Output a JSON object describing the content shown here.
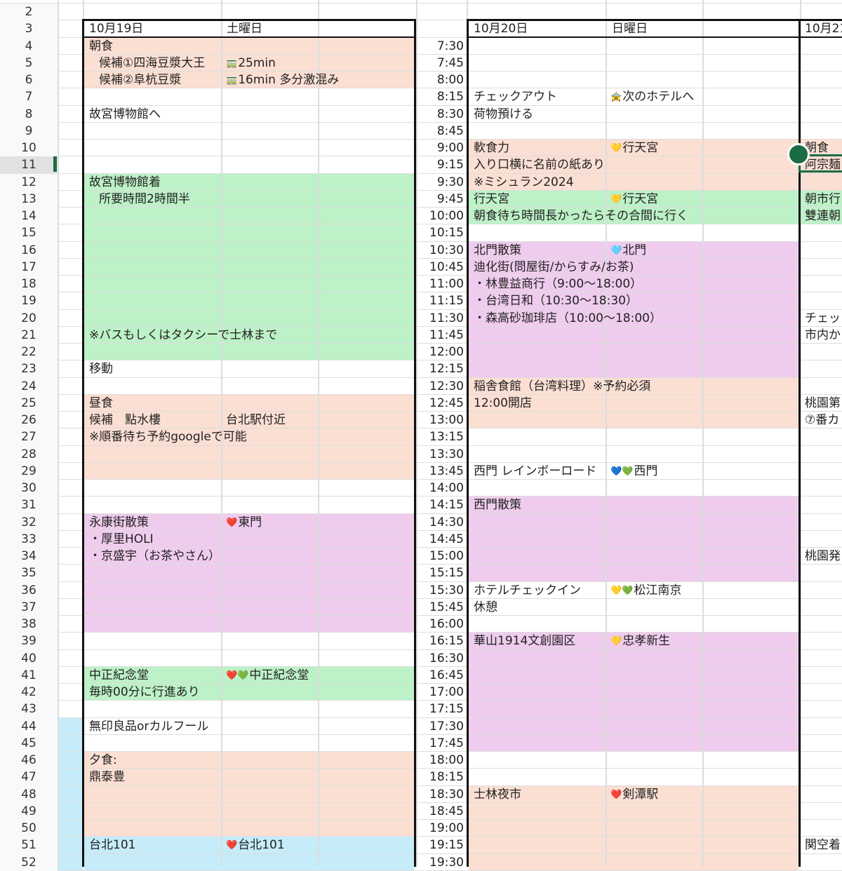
{
  "colors": {
    "breakfast": "#fbdfd3",
    "sight": "#bdf1c7",
    "walk": "#efcced",
    "blue": "#c6ecf9",
    "selection": "#1b6b43",
    "grid": "#dddddd"
  },
  "row_numbers": [
    "2",
    "3",
    "4",
    "5",
    "6",
    "7",
    "8",
    "9",
    "10",
    "11",
    "12",
    "13",
    "14",
    "15",
    "16",
    "17",
    "18",
    "19",
    "20",
    "21",
    "22",
    "23",
    "24",
    "25",
    "26",
    "27",
    "28",
    "29",
    "30",
    "31",
    "32",
    "33",
    "34",
    "35",
    "36",
    "37",
    "38",
    "39",
    "40",
    "41",
    "42",
    "43",
    "44",
    "45",
    "46",
    "47",
    "48",
    "49",
    "50",
    "51",
    "52"
  ],
  "selected_row": "11",
  "day1": {
    "date": "10月19日",
    "weekday": "土曜日",
    "cells": [
      {
        "r": 4,
        "c": "a",
        "text": "朝食"
      },
      {
        "r": 5,
        "c": "ai",
        "text": "候補①四海豆漿大王"
      },
      {
        "r": 5,
        "c": "b",
        "icon": "🚃",
        "icon_name": "train-icon",
        "text": "25min"
      },
      {
        "r": 6,
        "c": "ai",
        "text": "候補②阜杭豆漿"
      },
      {
        "r": 6,
        "c": "b",
        "icon": "🚃",
        "icon_name": "train-icon",
        "text": "16min 多分激混み"
      },
      {
        "r": 8,
        "c": "a",
        "text": "故宮博物館へ"
      },
      {
        "r": 12,
        "c": "a",
        "text": "故宮博物館着"
      },
      {
        "r": 13,
        "c": "ai",
        "text": "所要時間2時間半"
      },
      {
        "r": 21,
        "c": "a",
        "text": "※バスもしくはタクシーで士林まで"
      },
      {
        "r": 23,
        "c": "a",
        "text": "移動"
      },
      {
        "r": 25,
        "c": "a",
        "text": "昼食"
      },
      {
        "r": 26,
        "c": "a",
        "text": "候補　點水樓"
      },
      {
        "r": 26,
        "c": "b",
        "text": "台北駅付近"
      },
      {
        "r": 27,
        "c": "a",
        "text": "※順番待ち予約googleで可能"
      },
      {
        "r": 32,
        "c": "a",
        "text": "永康街散策"
      },
      {
        "r": 32,
        "c": "b",
        "icon": "❤️",
        "icon_name": "red-heart-icon",
        "text": "東門"
      },
      {
        "r": 33,
        "c": "a",
        "text": "・厚里HOLI"
      },
      {
        "r": 34,
        "c": "a",
        "text": "・京盛宇（お茶やさん）"
      },
      {
        "r": 41,
        "c": "a",
        "text": "中正紀念堂"
      },
      {
        "r": 41,
        "c": "b",
        "icon": "❤️💚",
        "icon_name": "red-green-heart-icon",
        "text": "中正紀念堂"
      },
      {
        "r": 42,
        "c": "a",
        "text": "毎時00分に行進あり"
      },
      {
        "r": 44,
        "c": "a",
        "text": "無印良品orカルフール"
      },
      {
        "r": 46,
        "c": "a",
        "text": "夕食:"
      },
      {
        "r": 47,
        "c": "a",
        "text": "鼎泰豊"
      },
      {
        "r": 51,
        "c": "a",
        "text": "台北101"
      },
      {
        "r": 51,
        "c": "b",
        "icon": "❤️",
        "icon_name": "red-heart-icon",
        "text": "台北101"
      }
    ]
  },
  "times": [
    "7:30",
    "7:45",
    "8:00",
    "8:15",
    "8:30",
    "8:45",
    "9:00",
    "9:15",
    "9:30",
    "9:45",
    "10:00",
    "10:15",
    "10:30",
    "10:45",
    "11:00",
    "11:15",
    "11:30",
    "11:45",
    "12:00",
    "12:15",
    "12:30",
    "12:45",
    "13:00",
    "13:15",
    "13:30",
    "13:45",
    "14:00",
    "14:15",
    "14:30",
    "14:45",
    "15:00",
    "15:15",
    "15:30",
    "15:45",
    "16:00",
    "16:15",
    "16:30",
    "16:45",
    "17:00",
    "17:15",
    "17:30",
    "17:45",
    "18:00",
    "18:15",
    "18:30",
    "18:45",
    "19:00",
    "19:15",
    "19:30"
  ],
  "day2": {
    "date": "10月20日",
    "weekday": "日曜日",
    "cells": [
      {
        "r": 7,
        "c": "a",
        "text": "チェックアウト"
      },
      {
        "r": 7,
        "c": "b",
        "icon": "🚖",
        "icon_name": "taxi-icon",
        "text": "次のホテルへ"
      },
      {
        "r": 8,
        "c": "a",
        "text": "荷物預ける"
      },
      {
        "r": 10,
        "c": "a",
        "text": "軟食力"
      },
      {
        "r": 10,
        "c": "b",
        "icon": "💛",
        "icon_name": "yellow-heart-icon",
        "text": "行天宮"
      },
      {
        "r": 11,
        "c": "a",
        "text": "入り口横に名前の紙あり"
      },
      {
        "r": 12,
        "c": "a",
        "text": "※ミシュラン2024"
      },
      {
        "r": 13,
        "c": "a",
        "text": "行天宮"
      },
      {
        "r": 13,
        "c": "b",
        "icon": "💛",
        "icon_name": "yellow-heart-icon",
        "text": "行天宮"
      },
      {
        "r": 14,
        "c": "a",
        "text": "朝食待ち時間長かったらその合間に行く"
      },
      {
        "r": 16,
        "c": "a",
        "text": "北門散策"
      },
      {
        "r": 16,
        "c": "b",
        "icon": "🩵",
        "icon_name": "light-blue-heart-icon",
        "text": "北門"
      },
      {
        "r": 17,
        "c": "a",
        "text": "迪化街(問屋街/からすみ/お茶)"
      },
      {
        "r": 18,
        "c": "a",
        "text": "・林豊益商行（9:00〜18:00）"
      },
      {
        "r": 19,
        "c": "a",
        "text": "・台湾日和（10:30〜18:30）"
      },
      {
        "r": 20,
        "c": "a",
        "text": "・森高砂珈琲店（10:00〜18:00）"
      },
      {
        "r": 24,
        "c": "a",
        "text": "稲舎食館（台湾料理）※予約必須"
      },
      {
        "r": 25,
        "c": "a",
        "text": "12:00開店"
      },
      {
        "r": 29,
        "c": "a",
        "text": "西門 レインボーロード"
      },
      {
        "r": 29,
        "c": "b",
        "icon": "💙💚",
        "icon_name": "blue-green-heart-icon",
        "text": "西門"
      },
      {
        "r": 31,
        "c": "a",
        "text": "西門散策"
      },
      {
        "r": 36,
        "c": "a",
        "text": "ホテルチェックイン"
      },
      {
        "r": 36,
        "c": "b",
        "icon": "💛💚",
        "icon_name": "yellow-green-heart-icon",
        "text": "松江南京"
      },
      {
        "r": 37,
        "c": "a",
        "text": "休憩"
      },
      {
        "r": 39,
        "c": "a",
        "text": "華山1914文創園区"
      },
      {
        "r": 39,
        "c": "b",
        "icon": "💛",
        "icon_name": "yellow-heart-icon",
        "text": "忠孝新生"
      },
      {
        "r": 48,
        "c": "a",
        "text": "士林夜市"
      },
      {
        "r": 48,
        "c": "b",
        "icon": "❤️",
        "icon_name": "red-heart-icon",
        "text": "剣潭駅"
      }
    ]
  },
  "day3": {
    "date": "10月21",
    "cells": [
      {
        "r": 10,
        "text": "朝食"
      },
      {
        "r": 11,
        "text": "阿宗麺"
      },
      {
        "r": 13,
        "text": "朝市行"
      },
      {
        "r": 14,
        "text": "雙連朝"
      },
      {
        "r": 20,
        "text": "チェッ"
      },
      {
        "r": 21,
        "text": "市内か"
      },
      {
        "r": 25,
        "text": "桃園第"
      },
      {
        "r": 26,
        "text": "⑦番カ"
      },
      {
        "r": 34,
        "text": "桃園発"
      },
      {
        "r": 51,
        "text": "関空着"
      }
    ]
  }
}
